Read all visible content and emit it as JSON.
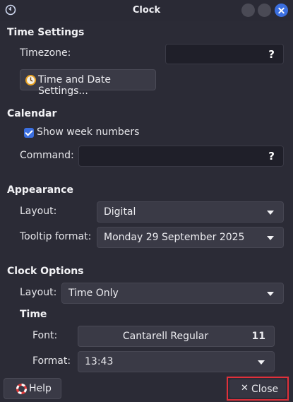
{
  "window": {
    "title": "Clock"
  },
  "time_settings": {
    "heading": "Time Settings",
    "timezone_label": "Timezone:",
    "timezone_value": "",
    "timezone_help": "?",
    "settings_button": "Time and Date Settings..."
  },
  "calendar": {
    "heading": "Calendar",
    "show_week_numbers_label": "Show week numbers",
    "show_week_numbers_checked": true,
    "command_label": "Command:",
    "command_value": "",
    "command_help": "?"
  },
  "appearance": {
    "heading": "Appearance",
    "layout_label": "Layout:",
    "layout_value": "Digital",
    "tooltip_label": "Tooltip format:",
    "tooltip_value": "Monday 29 September 2025"
  },
  "clock_options": {
    "heading": "Clock Options",
    "layout_label": "Layout:",
    "layout_value": "Time Only",
    "time_heading": "Time",
    "font_label": "Font:",
    "font_name": "Cantarell Regular",
    "font_size": "11",
    "format_label": "Format:",
    "format_value": "13:43"
  },
  "footer": {
    "help_label": "Help",
    "close_label": "Close"
  },
  "colors": {
    "background": "#2b2b36",
    "accent": "#3b6fe0",
    "highlight_border": "#e0303a"
  }
}
